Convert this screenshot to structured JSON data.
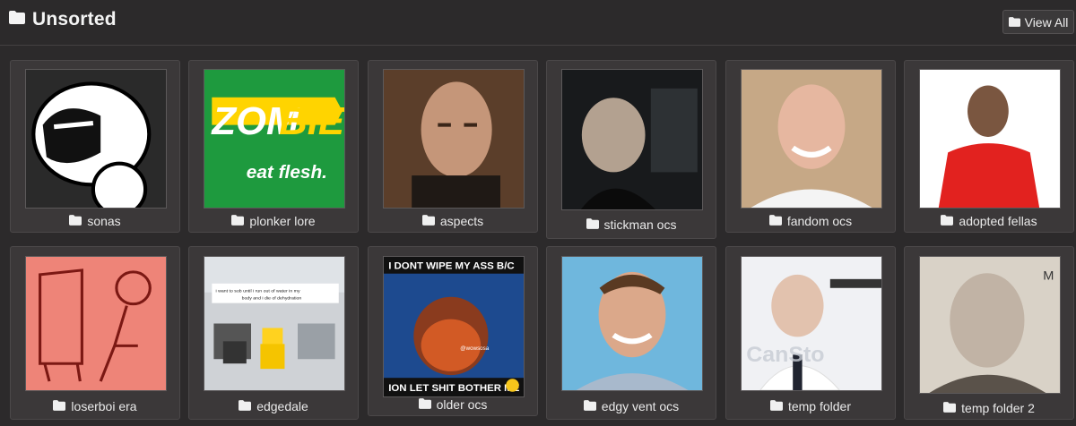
{
  "header": {
    "title": "Unsorted",
    "title_icon": "folder-icon",
    "view_all_label": "View All",
    "view_all_icon": "folder-icon"
  },
  "colors": {
    "background": "#2c2a2b",
    "card": "#3b3839",
    "text": "#eaeaea"
  },
  "folders": [
    {
      "label": "sonas",
      "icon": "folder-icon",
      "thumb": "cartoon-face"
    },
    {
      "label": "plonker lore",
      "icon": "folder-icon",
      "thumb": "zombie-eat-flesh"
    },
    {
      "label": "aspects",
      "icon": "folder-icon",
      "thumb": "man-portrait"
    },
    {
      "label": "stickman ocs",
      "icon": "folder-icon",
      "thumb": "dark-selfie"
    },
    {
      "label": "fandom ocs",
      "icon": "folder-icon",
      "thumb": "smiling-bald-man"
    },
    {
      "label": "adopted fellas",
      "icon": "folder-icon",
      "thumb": "man-red-shirt"
    },
    {
      "label": "loserboi era",
      "icon": "folder-icon",
      "thumb": "red-doodle"
    },
    {
      "label": "edgedale",
      "icon": "folder-icon",
      "thumb": "roblox-office"
    },
    {
      "label": "older ocs",
      "icon": "folder-icon",
      "thumb": "meme-poster"
    },
    {
      "label": "edgy vent ocs",
      "icon": "folder-icon",
      "thumb": "smiling-man-blue"
    },
    {
      "label": "temp folder",
      "icon": "folder-icon",
      "thumb": "stock-photo-man"
    },
    {
      "label": "temp folder 2",
      "icon": "folder-icon",
      "thumb": "bald-passport-photo"
    }
  ],
  "thumb_text": {
    "zombie_word_1": "ZOM",
    "zombie_word_2": "BIE",
    "zombie_sub": "eat flesh.",
    "roblox_caption_1": "i want to sob until i run out of water in my",
    "roblox_caption_2": "body and i die of dehydration",
    "meme_top": "I DONT WIPE MY ASS B/C",
    "meme_bottom": "ION LET SHIT BOTHER ME",
    "meme_watermark": "@wowsosa",
    "stock_watermark": "CanSto",
    "passport_mark": "M"
  }
}
